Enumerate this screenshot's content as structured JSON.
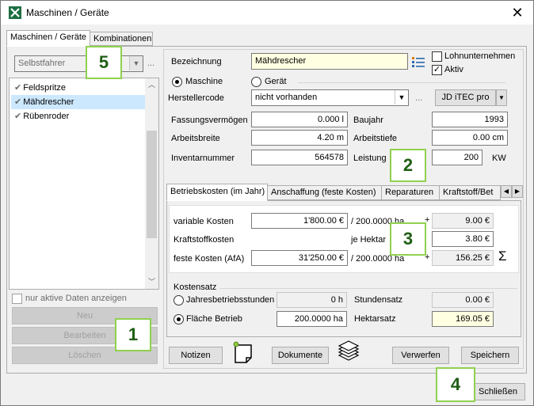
{
  "window": {
    "title": "Maschinen / Geräte",
    "close": "✕"
  },
  "tabs": [
    {
      "label": "Maschinen / Geräte",
      "active": true
    },
    {
      "label": "Kombinationen",
      "active": false
    }
  ],
  "left": {
    "filter_value": "Selbstfahrer",
    "filter_more": "...",
    "items": [
      {
        "label": "Feldspritze",
        "selected": false
      },
      {
        "label": "Mähdrescher",
        "selected": true
      },
      {
        "label": "Rübenroder",
        "selected": false
      }
    ],
    "only_active_label": "nur aktive Daten anzeigen",
    "buttons": {
      "new": "Neu",
      "edit": "Bearbeiten",
      "delete": "Löschen"
    }
  },
  "detail": {
    "bezeichnung_label": "Bezeichnung",
    "bezeichnung_value": "Mähdrescher",
    "lohnunternehmen_label": "Lohnunternehmen",
    "aktiv_label": "Aktiv",
    "maschine_label": "Maschine",
    "geraet_label": "Gerät",
    "herstellercode_label": "Herstellercode",
    "herstellercode_value": "nicht vorhanden",
    "herstellercode_more": "...",
    "jd_button": "JD iTEC pro",
    "fassungsvermoegen_label": "Fassungsvermögen",
    "fassungsvermoegen_value": "0.000 l",
    "baujahr_label": "Baujahr",
    "baujahr_value": "1993",
    "arbeitsbreite_label": "Arbeitsbreite",
    "arbeitsbreite_value": "4.20 m",
    "arbeitstiefe_label": "Arbeitstiefe",
    "arbeitstiefe_value": "0.00 cm",
    "inventarnummer_label": "Inventarnummer",
    "inventarnummer_value": "564578",
    "leistung_label": "Leistung",
    "leistung_value": "200",
    "leistung_unit": "KW"
  },
  "cost_tabs": [
    {
      "label": "Betriebskosten (im Jahr)",
      "active": true
    },
    {
      "label": "Anschaffung (feste Kosten)",
      "active": false
    },
    {
      "label": "Reparaturen",
      "active": false
    },
    {
      "label": "Kraftstoff/Bet",
      "active": false
    }
  ],
  "costs": {
    "variable_label": "variable Kosten",
    "variable_value": "1'800.00 €",
    "variable_per": "/ 200.0000 ha",
    "plus1": "+",
    "variable_result": "9.00 €",
    "kraftstoff_label": "Kraftstoffkosten",
    "je_hektar": "je Hektar",
    "kraftstoff_result": "3.80 €",
    "feste_label": "feste Kosten (AfA)",
    "feste_value": "31'250.00 €",
    "feste_per": "/ 200.0000 ha",
    "plus2": "+",
    "feste_result": "156.25 €",
    "sigma": "Σ"
  },
  "kostensatz": {
    "group_label": "Kostensatz",
    "jahresbetrieb_label": "Jahresbetriebsstunden",
    "jahresbetrieb_value": "0 h",
    "stundensatz_label": "Stundensatz",
    "stundensatz_value": "0.00 €",
    "flaeche_label": "Fläche Betrieb",
    "flaeche_value": "200.0000 ha",
    "hektarsatz_label": "Hektarsatz",
    "hektarsatz_value": "169.05 €"
  },
  "bottom": {
    "notizen": "Notizen",
    "dokumente": "Dokumente",
    "verwerfen": "Verwerfen",
    "speichern": "Speichern",
    "schliessen": "Schließen"
  },
  "markers": {
    "m1": "1",
    "m2": "2",
    "m3": "3",
    "m4": "4",
    "m5": "5"
  },
  "colors": {
    "marker_border": "#8fd14f",
    "marker_text": "#1f5e14",
    "selection": "#cce8ff",
    "highlight_field": "#ffffe1"
  }
}
